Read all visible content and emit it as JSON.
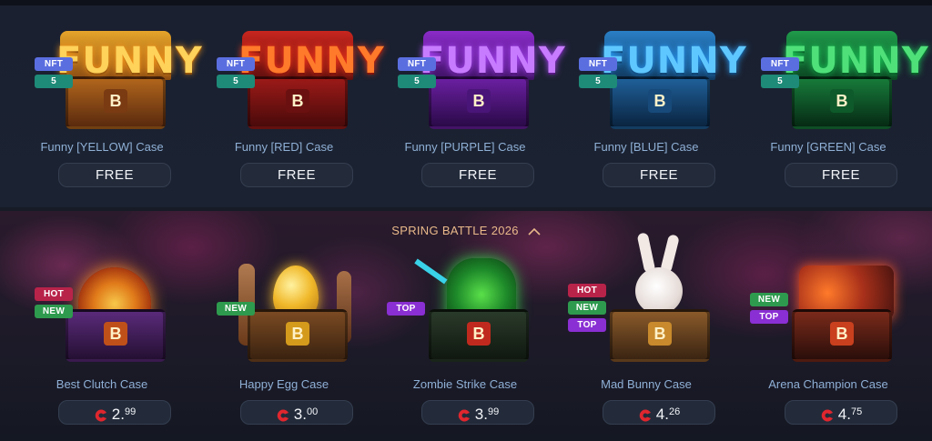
{
  "free_cases": [
    {
      "name": "Funny [YELLOW] Case",
      "badge_nft": "NFT",
      "badge_count": "5",
      "price": "FREE",
      "chest_text": "FUNNY",
      "logo": "B",
      "color_main": "#e6a52a",
      "color_dark": "#8a4a12",
      "color_text": "#ffd25a"
    },
    {
      "name": "Funny [RED] Case",
      "badge_nft": "NFT",
      "badge_count": "5",
      "price": "FREE",
      "chest_text": "FUNNY",
      "logo": "B",
      "color_main": "#c8261e",
      "color_dark": "#5e0f0e",
      "color_text": "#ff7a2a"
    },
    {
      "name": "Funny [PURPLE] Case",
      "badge_nft": "NFT",
      "badge_count": "5",
      "price": "FREE",
      "chest_text": "FUNNY",
      "logo": "B",
      "color_main": "#8a2bc9",
      "color_dark": "#3d1262",
      "color_text": "#c77bff"
    },
    {
      "name": "Funny [BLUE] Case",
      "badge_nft": "NFT",
      "badge_count": "5",
      "price": "FREE",
      "chest_text": "FUNNY",
      "logo": "B",
      "color_main": "#2a7fc6",
      "color_dark": "#10385e",
      "color_text": "#5fc7ff"
    },
    {
      "name": "Funny [GREEN] Case",
      "badge_nft": "NFT",
      "badge_count": "5",
      "price": "FREE",
      "chest_text": "FUNNY",
      "logo": "B",
      "color_main": "#1f9a4a",
      "color_dark": "#0b4422",
      "color_text": "#4fe07a"
    }
  ],
  "battle_section": {
    "title": "SPRING BATTLE 2026",
    "cases": [
      {
        "name": "Best Clutch Case",
        "badges": [
          "HOT",
          "NEW"
        ],
        "price_int": "2.",
        "price_dec": "99",
        "logo": "B",
        "color_main": "#c0501a",
        "color_dark": "#3a1f4a"
      },
      {
        "name": "Happy Egg Case",
        "badges": [
          "NEW"
        ],
        "price_int": "3.",
        "price_dec": "00",
        "logo": "B",
        "color_main": "#d49a1c",
        "color_dark": "#4a2a18"
      },
      {
        "name": "Zombie Strike Case",
        "badges": [
          "TOP"
        ],
        "price_int": "3.",
        "price_dec": "99",
        "logo": "B",
        "color_main": "#2fa83a",
        "color_dark": "#183020"
      },
      {
        "name": "Mad Bunny Case",
        "badges": [
          "HOT",
          "NEW",
          "TOP"
        ],
        "price_int": "4.",
        "price_dec": "26",
        "logo": "B",
        "color_main": "#c88a2c",
        "color_dark": "#3a2418"
      },
      {
        "name": "Arena Champion Case",
        "badges": [
          "NEW",
          "TOP"
        ],
        "price_int": "4.",
        "price_dec": "75",
        "logo": "B",
        "color_main": "#c9401e",
        "color_dark": "#3a1a18"
      }
    ]
  },
  "icons": {
    "coin": "red-coin-icon",
    "chevron": "chevron-up-icon"
  },
  "colors": {
    "accent_title": "#e9b98a",
    "case_name": "#8fb0d6",
    "button_bg": "#232b3a"
  }
}
